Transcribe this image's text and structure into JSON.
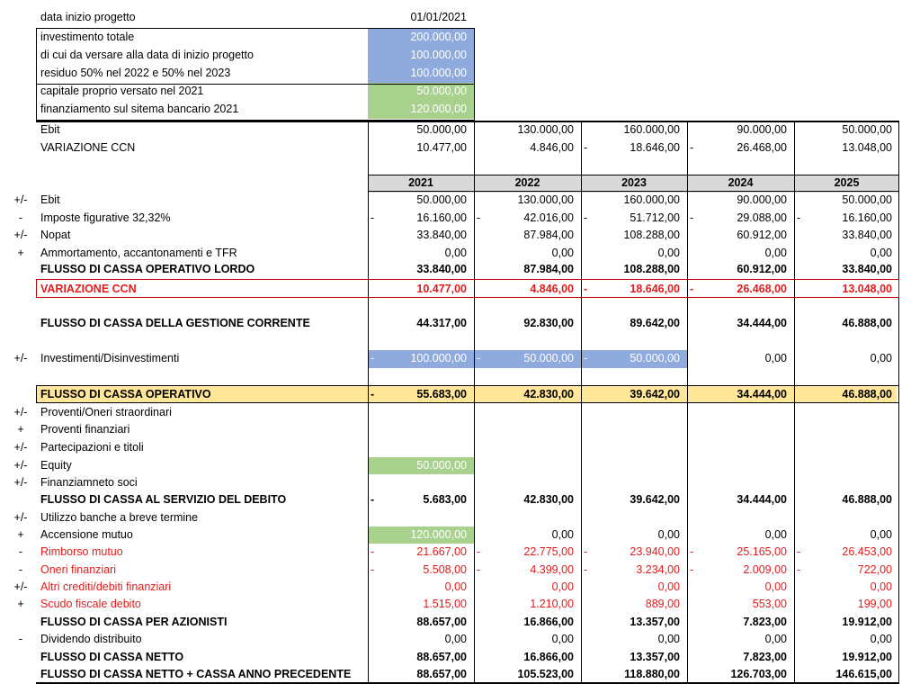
{
  "header": {
    "start_label": "data inizio progetto",
    "start_value": "01/01/2021",
    "items": [
      {
        "label": "investimento totale",
        "value": "200.000,00",
        "fill": "blue"
      },
      {
        "label": "di cui da versare alla data di inizio progetto",
        "value": "100.000,00",
        "fill": "blue"
      },
      {
        "label": "residuo 50% nel 2022 e 50% nel 2023",
        "value": "100.000,00",
        "fill": "blue"
      },
      {
        "label": "capitale proprio versato nel 2021",
        "value": "50.000,00",
        "fill": "green"
      },
      {
        "label": "finanziamento sul sitema bancario 2021",
        "value": "120.000,00",
        "fill": "green"
      }
    ]
  },
  "top": [
    {
      "label": "Ebit",
      "values": [
        "50.000,00",
        "130.000,00",
        "160.000,00",
        "90.000,00",
        "50.000,00"
      ],
      "neg": [
        false,
        false,
        false,
        false,
        false
      ]
    },
    {
      "label": "VARIAZIONE CCN",
      "values": [
        "10.477,00",
        "4.846,00",
        "18.646,00",
        "26.468,00",
        "13.048,00"
      ],
      "neg": [
        false,
        false,
        true,
        true,
        false
      ]
    }
  ],
  "years": [
    "2021",
    "2022",
    "2023",
    "2024",
    "2025"
  ],
  "rows": [
    {
      "sign": "+/-",
      "label": "Ebit",
      "values": [
        "50.000,00",
        "130.000,00",
        "160.000,00",
        "90.000,00",
        "50.000,00"
      ],
      "neg": [
        false,
        false,
        false,
        false,
        false
      ]
    },
    {
      "sign": "-",
      "label": "Imposte figurative 32,32%",
      "values": [
        "16.160,00",
        "42.016,00",
        "51.712,00",
        "29.088,00",
        "16.160,00"
      ],
      "neg": [
        true,
        true,
        true,
        true,
        true
      ]
    },
    {
      "sign": "+/-",
      "label": "Nopat",
      "values": [
        "33.840,00",
        "87.984,00",
        "108.288,00",
        "60.912,00",
        "33.840,00"
      ],
      "neg": [
        false,
        false,
        false,
        false,
        false
      ]
    },
    {
      "sign": "+",
      "label": "Ammortamento, accantonamenti e TFR",
      "values": [
        "0,00",
        "0,00",
        "0,00",
        "0,00",
        "0,00"
      ],
      "neg": [
        false,
        false,
        false,
        false,
        false
      ]
    },
    {
      "sign": "",
      "label": "FLUSSO DI CASSA OPERATIVO LORDO",
      "values": [
        "33.840,00",
        "87.984,00",
        "108.288,00",
        "60.912,00",
        "33.840,00"
      ],
      "neg": [
        false,
        false,
        false,
        false,
        false
      ],
      "style": "bold"
    },
    {
      "sign": "",
      "label": "VARIAZIONE CCN",
      "values": [
        "10.477,00",
        "4.846,00",
        "18.646,00",
        "26.468,00",
        "13.048,00"
      ],
      "neg": [
        false,
        false,
        true,
        true,
        false
      ],
      "style": "bold red"
    },
    {
      "sign": "",
      "label": "FLUSSO DI CASSA DELLA GESTIONE CORRENTE",
      "values": [
        "44.317,00",
        "92.830,00",
        "89.642,00",
        "34.444,00",
        "46.888,00"
      ],
      "neg": [
        false,
        false,
        false,
        false,
        false
      ],
      "style": "bold"
    },
    {
      "sign": "+/-",
      "label": "Investimenti/Disinvestimenti",
      "values": [
        "100.000,00",
        "50.000,00",
        "50.000,00",
        "0,00",
        "0,00"
      ],
      "neg": [
        true,
        true,
        true,
        false,
        false
      ],
      "fill": [
        "blue",
        "blue",
        "blue",
        "",
        ""
      ]
    },
    {
      "sign": "",
      "label": "FLUSSO DI CASSA OPERATIVO",
      "values": [
        "55.683,00",
        "42.830,00",
        "39.642,00",
        "34.444,00",
        "46.888,00"
      ],
      "neg": [
        true,
        false,
        false,
        false,
        false
      ],
      "style": "bold"
    },
    {
      "sign": "+/-",
      "label": "Proventi/Oneri straordinari",
      "values": [
        "",
        "",
        "",
        "",
        ""
      ],
      "neg": [
        false,
        false,
        false,
        false,
        false
      ]
    },
    {
      "sign": "+",
      "label": "Proventi finanziari",
      "values": [
        "",
        "",
        "",
        "",
        ""
      ],
      "neg": [
        false,
        false,
        false,
        false,
        false
      ]
    },
    {
      "sign": "+/-",
      "label": "Partecipazioni e titoli",
      "values": [
        "",
        "",
        "",
        "",
        ""
      ],
      "neg": [
        false,
        false,
        false,
        false,
        false
      ]
    },
    {
      "sign": "+/-",
      "label": "Equity",
      "values": [
        "50.000,00",
        "",
        "",
        "",
        ""
      ],
      "neg": [
        false,
        false,
        false,
        false,
        false
      ],
      "fill": [
        "green",
        "",
        "",
        "",
        ""
      ]
    },
    {
      "sign": "+/-",
      "label": "Finanziamneto soci",
      "values": [
        "",
        "",
        "",
        "",
        ""
      ],
      "neg": [
        false,
        false,
        false,
        false,
        false
      ]
    },
    {
      "sign": "",
      "label": "FLUSSO DI CASSA AL SERVIZIO DEL DEBITO",
      "values": [
        "5.683,00",
        "42.830,00",
        "39.642,00",
        "34.444,00",
        "46.888,00"
      ],
      "neg": [
        true,
        false,
        false,
        false,
        false
      ],
      "style": "bold"
    },
    {
      "sign": "+/-",
      "label": "Utilizzo banche a breve termine",
      "values": [
        "",
        "",
        "",
        "",
        ""
      ],
      "neg": [
        false,
        false,
        false,
        false,
        false
      ]
    },
    {
      "sign": "+",
      "label": "Accensione mutuo",
      "values": [
        "120.000,00",
        "0,00",
        "0,00",
        "0,00",
        "0,00"
      ],
      "neg": [
        false,
        false,
        false,
        false,
        false
      ],
      "fill": [
        "green",
        "",
        "",
        "",
        ""
      ]
    },
    {
      "sign": "-",
      "label": "Rimborso mutuo",
      "values": [
        "21.667,00",
        "22.775,00",
        "23.940,00",
        "25.165,00",
        "26.453,00"
      ],
      "neg": [
        true,
        true,
        true,
        true,
        true
      ],
      "style": "red"
    },
    {
      "sign": "-",
      "label": "Oneri finanziari",
      "values": [
        "5.508,00",
        "4.399,00",
        "3.234,00",
        "2.009,00",
        "722,00"
      ],
      "neg": [
        true,
        true,
        true,
        true,
        true
      ],
      "style": "red"
    },
    {
      "sign": "+/-",
      "label": "Altri crediti/debiti finanziari",
      "values": [
        "0,00",
        "0,00",
        "0,00",
        "0,00",
        "0,00"
      ],
      "neg": [
        false,
        false,
        false,
        false,
        false
      ],
      "style": "red"
    },
    {
      "sign": "+",
      "label": "Scudo fiscale debito",
      "values": [
        "1.515,00",
        "1.210,00",
        "889,00",
        "553,00",
        "199,00"
      ],
      "neg": [
        false,
        false,
        false,
        false,
        false
      ],
      "style": "red"
    },
    {
      "sign": "",
      "label": "FLUSSO DI CASSA PER AZIONISTI",
      "values": [
        "88.657,00",
        "16.866,00",
        "13.357,00",
        "7.823,00",
        "19.912,00"
      ],
      "neg": [
        false,
        false,
        false,
        false,
        false
      ],
      "style": "bold"
    },
    {
      "sign": "-",
      "label": "Dividendo distribuito",
      "values": [
        "0,00",
        "0,00",
        "0,00",
        "0,00",
        "0,00"
      ],
      "neg": [
        false,
        false,
        false,
        false,
        false
      ]
    },
    {
      "sign": "",
      "label": "FLUSSO DI CASSA NETTO",
      "values": [
        "88.657,00",
        "16.866,00",
        "13.357,00",
        "7.823,00",
        "19.912,00"
      ],
      "neg": [
        false,
        false,
        false,
        false,
        false
      ],
      "style": "bold"
    },
    {
      "sign": "",
      "label": "FLUSSO DI CASSA NETTO + CASSA ANNO PRECEDENTE",
      "values": [
        "88.657,00",
        "105.523,00",
        "118.880,00",
        "126.703,00",
        "146.615,00"
      ],
      "neg": [
        false,
        false,
        false,
        false,
        false
      ],
      "style": "bold"
    }
  ],
  "neg_sign": "-",
  "colors": {
    "blue": "#8faadc",
    "green": "#a9d18e",
    "header_gray": "#d9d9d9",
    "highlight_yellow": "#ffe699",
    "red_text": "#e41b1b"
  }
}
